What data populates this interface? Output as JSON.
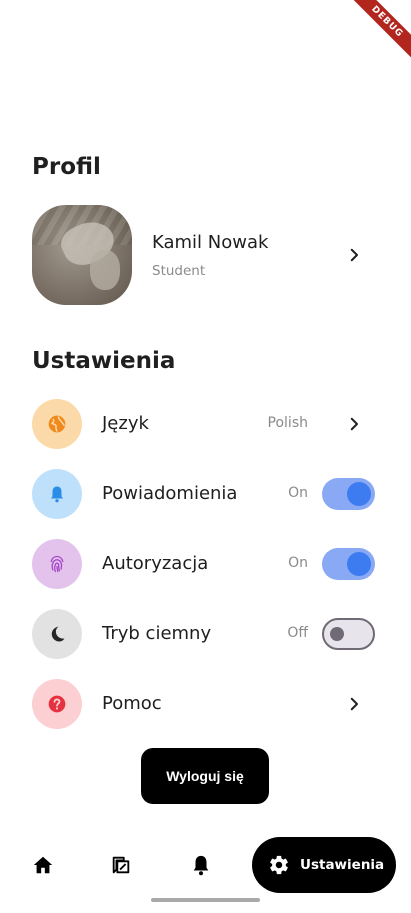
{
  "debug_banner": "DEBUG",
  "profile_section": {
    "title": "Profil",
    "name": "Kamil Nowak",
    "role": "Student"
  },
  "settings_section": {
    "title": "Ustawienia",
    "items": [
      {
        "label": "Język",
        "value": "Polish",
        "icon": "globe-icon",
        "icon_bg": "#fcd9a8",
        "icon_color": "#f08a1c"
      },
      {
        "label": "Powiadomienia",
        "value": "On",
        "icon": "bell-icon",
        "icon_bg": "#bfe0fb",
        "icon_color": "#2a8ee8",
        "toggle": true
      },
      {
        "label": "Autoryzacja",
        "value": "On",
        "icon": "fingerprint-icon",
        "icon_bg": "#e3c3ec",
        "icon_color": "#a347c7",
        "toggle": true
      },
      {
        "label": "Tryb ciemny",
        "value": "Off",
        "icon": "moon-icon",
        "icon_bg": "#e2e2e2",
        "icon_color": "#262626",
        "toggle": false
      },
      {
        "label": "Pomoc",
        "value": "",
        "icon": "help-icon",
        "icon_bg": "#fccfd2",
        "icon_color": "#e53240"
      }
    ]
  },
  "logout_label": "Wyloguj się",
  "bottom_nav": {
    "items": [
      "home-icon",
      "book-icon",
      "notifications-icon"
    ],
    "active_label": "Ustawienia",
    "active_icon": "settings-gear-icon"
  },
  "colors": {
    "toggle_on_track": "#89a9f5",
    "toggle_on_knob": "#3d7bf0",
    "accent_black": "#000000"
  }
}
